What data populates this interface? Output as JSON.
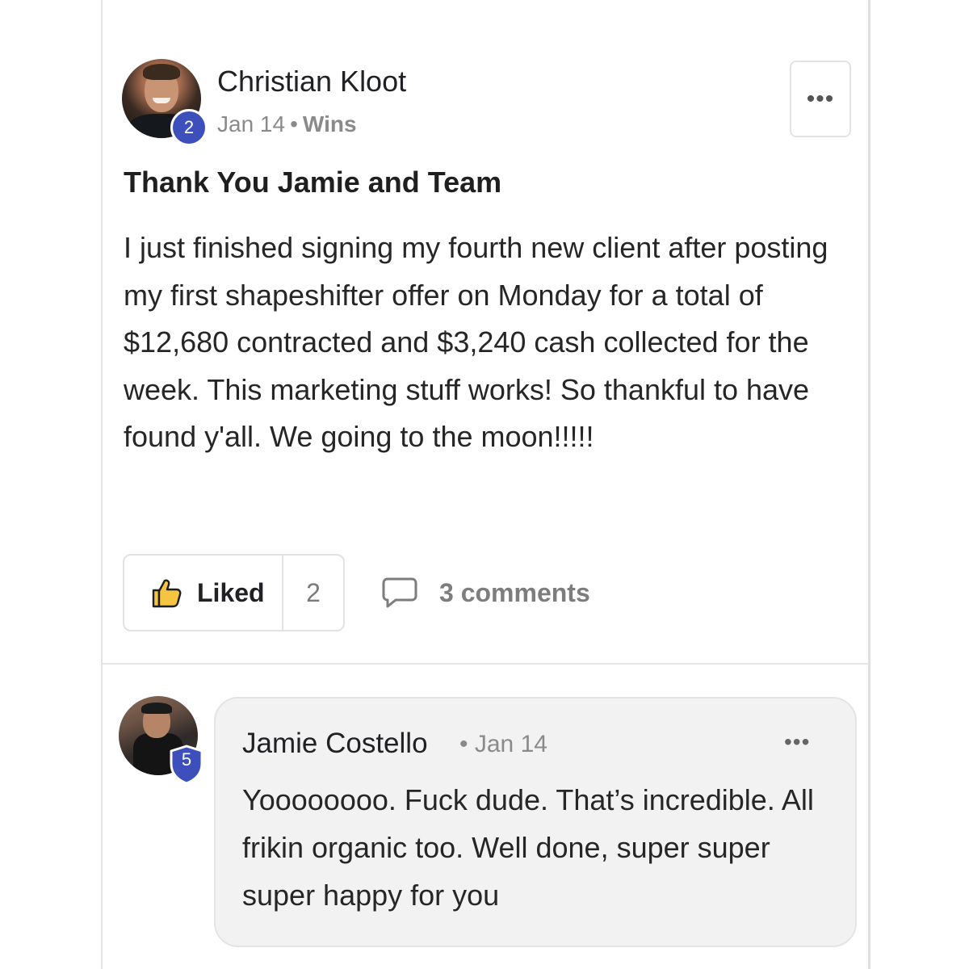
{
  "post": {
    "author": {
      "name": "Christian Kloot",
      "level": "2",
      "level_color": "#3d4fbb"
    },
    "date": "Jan 14",
    "separator": "•",
    "category": "Wins",
    "title": "Thank You Jamie and Team",
    "body": "I just finished signing my fourth new client after posting my first shapeshifter offer on Monday for a total of $12,680 contracted and $3,240 cash collected for the week. This marketing stuff works! So thankful to have found y'all. We going to the moon!!!!!",
    "more_icon": "ellipsis-icon",
    "more_label": "•••"
  },
  "actions": {
    "like_label": "Liked",
    "like_icon": "thumbs-up-icon",
    "like_count": "2",
    "comments_icon": "speech-bubble-icon",
    "comments_label": "3 comments"
  },
  "comments": [
    {
      "author": "Jamie Costello",
      "level": "5",
      "level_color": "#3d4fbb",
      "separator": "•",
      "date": "Jan 14",
      "text": "Yoooooooo. Fuck dude. That’s incredible. All frikin organic too. Well done, super super super happy for you",
      "more_label": "•••"
    }
  ]
}
